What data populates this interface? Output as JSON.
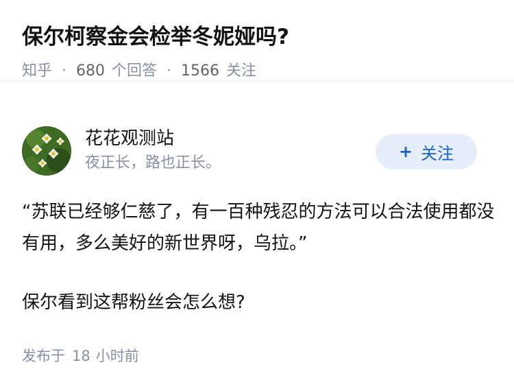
{
  "question": {
    "title": "保尔柯察金会检举冬妮娅吗?",
    "source": "知乎",
    "answer_count": "680",
    "answer_unit": "个回答",
    "follow_count": "1566",
    "follow_unit": "关注",
    "separator": "·"
  },
  "author": {
    "name": "花花观测站",
    "bio": "夜正长，路也正长。",
    "avatar_icon": "daisy-flowers-avatar",
    "follow_plus": "+",
    "follow_label": "关注"
  },
  "answer": {
    "paragraphs": [
      "“苏联已经够仁慈了，有一百种残忍的方法可以合法使用都没有用，多么美好的新世界呀，乌拉。”",
      "保尔看到这帮粉丝会怎么想?"
    ],
    "publish_prefix": "发布于",
    "publish_num": "18",
    "publish_unit": "小时前"
  },
  "colors": {
    "title": "#121212",
    "meta": "#8590a6",
    "follow_bg": "#e5eefa",
    "follow_text": "#1661c8"
  }
}
